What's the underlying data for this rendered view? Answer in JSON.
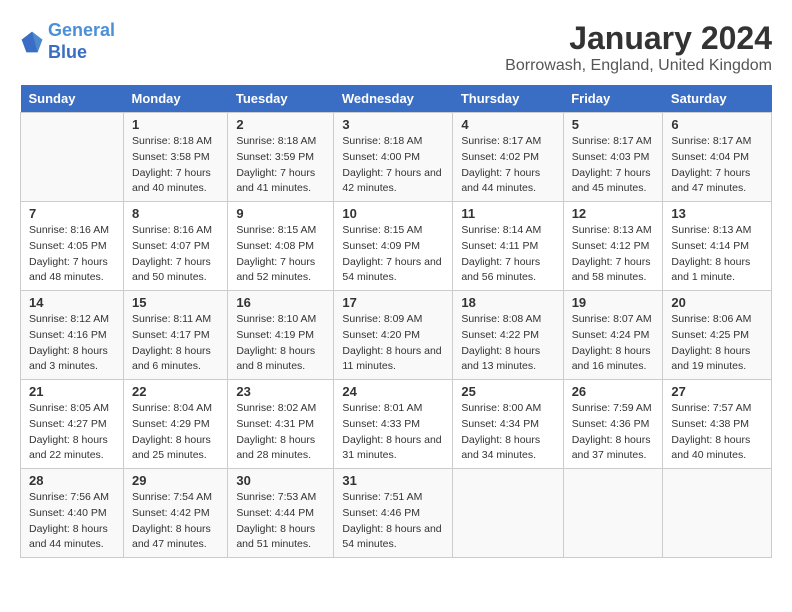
{
  "logo": {
    "line1": "General",
    "line2": "Blue"
  },
  "title": "January 2024",
  "subtitle": "Borrowash, England, United Kingdom",
  "days_of_week": [
    "Sunday",
    "Monday",
    "Tuesday",
    "Wednesday",
    "Thursday",
    "Friday",
    "Saturday"
  ],
  "weeks": [
    [
      {
        "day": "",
        "sunrise": "",
        "sunset": "",
        "daylight": "",
        "empty": true
      },
      {
        "day": "1",
        "sunrise": "8:18 AM",
        "sunset": "3:58 PM",
        "daylight": "7 hours and 40 minutes."
      },
      {
        "day": "2",
        "sunrise": "8:18 AM",
        "sunset": "3:59 PM",
        "daylight": "7 hours and 41 minutes."
      },
      {
        "day": "3",
        "sunrise": "8:18 AM",
        "sunset": "4:00 PM",
        "daylight": "7 hours and 42 minutes."
      },
      {
        "day": "4",
        "sunrise": "8:17 AM",
        "sunset": "4:02 PM",
        "daylight": "7 hours and 44 minutes."
      },
      {
        "day": "5",
        "sunrise": "8:17 AM",
        "sunset": "4:03 PM",
        "daylight": "7 hours and 45 minutes."
      },
      {
        "day": "6",
        "sunrise": "8:17 AM",
        "sunset": "4:04 PM",
        "daylight": "7 hours and 47 minutes."
      }
    ],
    [
      {
        "day": "7",
        "sunrise": "8:16 AM",
        "sunset": "4:05 PM",
        "daylight": "7 hours and 48 minutes."
      },
      {
        "day": "8",
        "sunrise": "8:16 AM",
        "sunset": "4:07 PM",
        "daylight": "7 hours and 50 minutes."
      },
      {
        "day": "9",
        "sunrise": "8:15 AM",
        "sunset": "4:08 PM",
        "daylight": "7 hours and 52 minutes."
      },
      {
        "day": "10",
        "sunrise": "8:15 AM",
        "sunset": "4:09 PM",
        "daylight": "7 hours and 54 minutes."
      },
      {
        "day": "11",
        "sunrise": "8:14 AM",
        "sunset": "4:11 PM",
        "daylight": "7 hours and 56 minutes."
      },
      {
        "day": "12",
        "sunrise": "8:13 AM",
        "sunset": "4:12 PM",
        "daylight": "7 hours and 58 minutes."
      },
      {
        "day": "13",
        "sunrise": "8:13 AM",
        "sunset": "4:14 PM",
        "daylight": "8 hours and 1 minute."
      }
    ],
    [
      {
        "day": "14",
        "sunrise": "8:12 AM",
        "sunset": "4:16 PM",
        "daylight": "8 hours and 3 minutes."
      },
      {
        "day": "15",
        "sunrise": "8:11 AM",
        "sunset": "4:17 PM",
        "daylight": "8 hours and 6 minutes."
      },
      {
        "day": "16",
        "sunrise": "8:10 AM",
        "sunset": "4:19 PM",
        "daylight": "8 hours and 8 minutes."
      },
      {
        "day": "17",
        "sunrise": "8:09 AM",
        "sunset": "4:20 PM",
        "daylight": "8 hours and 11 minutes."
      },
      {
        "day": "18",
        "sunrise": "8:08 AM",
        "sunset": "4:22 PM",
        "daylight": "8 hours and 13 minutes."
      },
      {
        "day": "19",
        "sunrise": "8:07 AM",
        "sunset": "4:24 PM",
        "daylight": "8 hours and 16 minutes."
      },
      {
        "day": "20",
        "sunrise": "8:06 AM",
        "sunset": "4:25 PM",
        "daylight": "8 hours and 19 minutes."
      }
    ],
    [
      {
        "day": "21",
        "sunrise": "8:05 AM",
        "sunset": "4:27 PM",
        "daylight": "8 hours and 22 minutes."
      },
      {
        "day": "22",
        "sunrise": "8:04 AM",
        "sunset": "4:29 PM",
        "daylight": "8 hours and 25 minutes."
      },
      {
        "day": "23",
        "sunrise": "8:02 AM",
        "sunset": "4:31 PM",
        "daylight": "8 hours and 28 minutes."
      },
      {
        "day": "24",
        "sunrise": "8:01 AM",
        "sunset": "4:33 PM",
        "daylight": "8 hours and 31 minutes."
      },
      {
        "day": "25",
        "sunrise": "8:00 AM",
        "sunset": "4:34 PM",
        "daylight": "8 hours and 34 minutes."
      },
      {
        "day": "26",
        "sunrise": "7:59 AM",
        "sunset": "4:36 PM",
        "daylight": "8 hours and 37 minutes."
      },
      {
        "day": "27",
        "sunrise": "7:57 AM",
        "sunset": "4:38 PM",
        "daylight": "8 hours and 40 minutes."
      }
    ],
    [
      {
        "day": "28",
        "sunrise": "7:56 AM",
        "sunset": "4:40 PM",
        "daylight": "8 hours and 44 minutes."
      },
      {
        "day": "29",
        "sunrise": "7:54 AM",
        "sunset": "4:42 PM",
        "daylight": "8 hours and 47 minutes."
      },
      {
        "day": "30",
        "sunrise": "7:53 AM",
        "sunset": "4:44 PM",
        "daylight": "8 hours and 51 minutes."
      },
      {
        "day": "31",
        "sunrise": "7:51 AM",
        "sunset": "4:46 PM",
        "daylight": "8 hours and 54 minutes."
      },
      {
        "day": "",
        "empty": true
      },
      {
        "day": "",
        "empty": true
      },
      {
        "day": "",
        "empty": true
      }
    ]
  ],
  "labels": {
    "sunrise_prefix": "Sunrise: ",
    "sunset_prefix": "Sunset: ",
    "daylight_prefix": "Daylight: "
  }
}
